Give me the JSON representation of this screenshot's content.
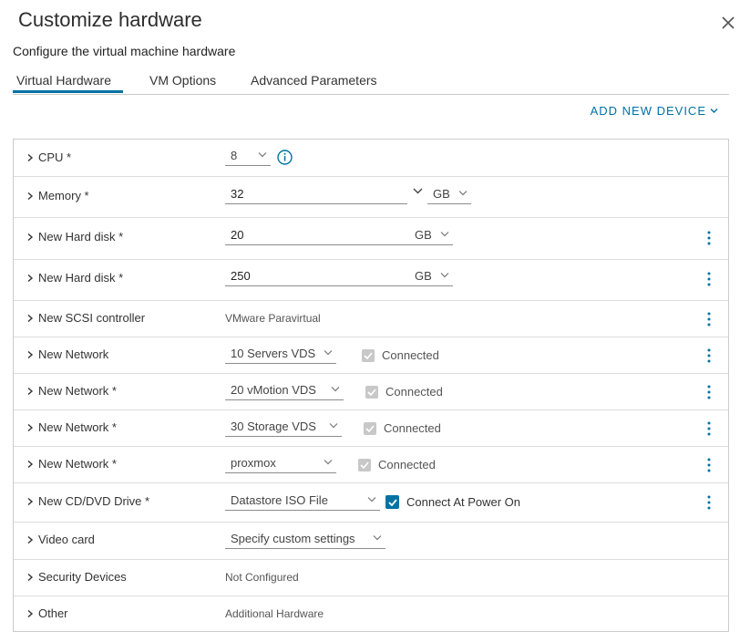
{
  "dialog": {
    "title": "Customize hardware",
    "subtitle": "Configure the virtual machine hardware"
  },
  "tabs": [
    {
      "label": "Virtual Hardware",
      "active": true
    },
    {
      "label": "VM Options",
      "active": false
    },
    {
      "label": "Advanced Parameters",
      "active": false
    }
  ],
  "toolbar": {
    "add_device_label": "ADD NEW DEVICE"
  },
  "rows": {
    "cpu": {
      "label": "CPU *",
      "value": "8"
    },
    "memory": {
      "label": "Memory *",
      "value": "32",
      "unit": "GB"
    },
    "disk1": {
      "label": "New Hard disk *",
      "value": "20",
      "unit": "GB"
    },
    "disk2": {
      "label": "New Hard disk *",
      "value": "250",
      "unit": "GB"
    },
    "scsi": {
      "label": "New SCSI controller",
      "value": "VMware Paravirtual"
    },
    "net1": {
      "label": "New Network",
      "value": "10 Servers VDS",
      "checkbox_label": "Connected"
    },
    "net2": {
      "label": "New Network *",
      "value": "20 vMotion VDS",
      "checkbox_label": "Connected"
    },
    "net3": {
      "label": "New Network *",
      "value": "30 Storage VDS",
      "checkbox_label": "Connected"
    },
    "net4": {
      "label": "New Network *",
      "value": "proxmox",
      "checkbox_label": "Connected"
    },
    "cdrom": {
      "label": "New CD/DVD Drive *",
      "value": "Datastore ISO File",
      "checkbox_label": "Connect At Power On"
    },
    "video": {
      "label": "Video card",
      "value": "Specify custom settings"
    },
    "security": {
      "label": "Security Devices",
      "value": "Not Configured"
    },
    "other": {
      "label": "Other",
      "value": "Additional Hardware"
    }
  },
  "colors": {
    "accent": "#0072a3",
    "border": "#cccccc",
    "disabled_checkbox": "#c8c8c8"
  },
  "icons": [
    "close-icon",
    "chevron-right-icon",
    "chevron-down-icon",
    "info-icon",
    "kebab-menu-icon",
    "checkmark-icon"
  ]
}
